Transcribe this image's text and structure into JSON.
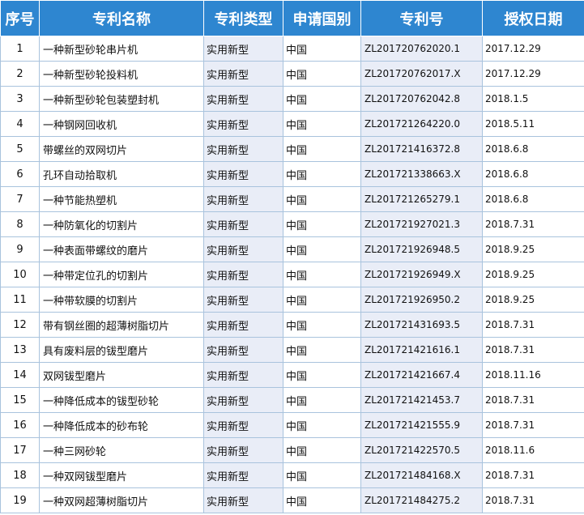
{
  "headers": {
    "index": "序号",
    "name": "专利名称",
    "type": "专利类型",
    "country": "申请国别",
    "number": "专利号",
    "date": "授权日期"
  },
  "rows": [
    {
      "index": "1",
      "name": "一种新型砂轮串片机",
      "type": "实用新型",
      "country": "中国",
      "number": "ZL201720762020.1",
      "date": "2017.12.29"
    },
    {
      "index": "2",
      "name": "一种新型砂轮投料机",
      "type": "实用新型",
      "country": "中国",
      "number": "ZL201720762017.X",
      "date": "2017.12.29"
    },
    {
      "index": "3",
      "name": "一种新型砂轮包装塑封机",
      "type": "实用新型",
      "country": "中国",
      "number": "ZL201720762042.8",
      "date": "2018.1.5"
    },
    {
      "index": "4",
      "name": "一种钢网回收机",
      "type": "实用新型",
      "country": "中国",
      "number": "ZL201721264220.0",
      "date": "2018.5.11"
    },
    {
      "index": "5",
      "name": "带螺丝的双网切片",
      "type": "实用新型",
      "country": "中国",
      "number": "ZL201721416372.8",
      "date": "2018.6.8"
    },
    {
      "index": "6",
      "name": "孔环自动拾取机",
      "type": "实用新型",
      "country": "中国",
      "number": "ZL201721338663.X",
      "date": "2018.6.8"
    },
    {
      "index": "7",
      "name": "一种节能热塑机",
      "type": "实用新型",
      "country": "中国",
      "number": "ZL201721265279.1",
      "date": "2018.6.8"
    },
    {
      "index": "8",
      "name": "一种防氧化的切割片",
      "type": "实用新型",
      "country": "中国",
      "number": "ZL201721927021.3",
      "date": "2018.7.31"
    },
    {
      "index": "9",
      "name": "一种表面带螺纹的磨片",
      "type": "实用新型",
      "country": "中国",
      "number": "ZL201721926948.5",
      "date": "2018.9.25"
    },
    {
      "index": "10",
      "name": "一种带定位孔的切割片",
      "type": "实用新型",
      "country": "中国",
      "number": "ZL201721926949.X",
      "date": "2018.9.25"
    },
    {
      "index": "11",
      "name": "一种带软膜的切割片",
      "type": "实用新型",
      "country": "中国",
      "number": "ZL201721926950.2",
      "date": "2018.9.25"
    },
    {
      "index": "12",
      "name": "带有钢丝圈的超薄树脂切片",
      "type": "实用新型",
      "country": "中国",
      "number": "ZL201721431693.5",
      "date": "2018.7.31"
    },
    {
      "index": "13",
      "name": "具有废料层的钹型磨片",
      "type": "实用新型",
      "country": "中国",
      "number": "ZL201721421616.1",
      "date": "2018.7.31"
    },
    {
      "index": "14",
      "name": "双网钹型磨片",
      "type": "实用新型",
      "country": "中国",
      "number": "ZL201721421667.4",
      "date": "2018.11.16"
    },
    {
      "index": "15",
      "name": "一种降低成本的钹型砂轮",
      "type": "实用新型",
      "country": "中国",
      "number": "ZL201721421453.7",
      "date": "2018.7.31"
    },
    {
      "index": "16",
      "name": "一种降低成本的砂布轮",
      "type": "实用新型",
      "country": "中国",
      "number": "ZL201721421555.9",
      "date": "2018.7.31"
    },
    {
      "index": "17",
      "name": "一种三网砂轮",
      "type": "实用新型",
      "country": "中国",
      "number": "ZL201721422570.5",
      "date": "2018.11.6"
    },
    {
      "index": "18",
      "name": "一种双网钹型磨片",
      "type": "实用新型",
      "country": "中国",
      "number": "ZL201721484168.X",
      "date": "2018.7.31"
    },
    {
      "index": "19",
      "name": "一种双网超薄树脂切片",
      "type": "实用新型",
      "country": "中国",
      "number": "ZL201721484275.2",
      "date": "2018.7.31"
    }
  ]
}
